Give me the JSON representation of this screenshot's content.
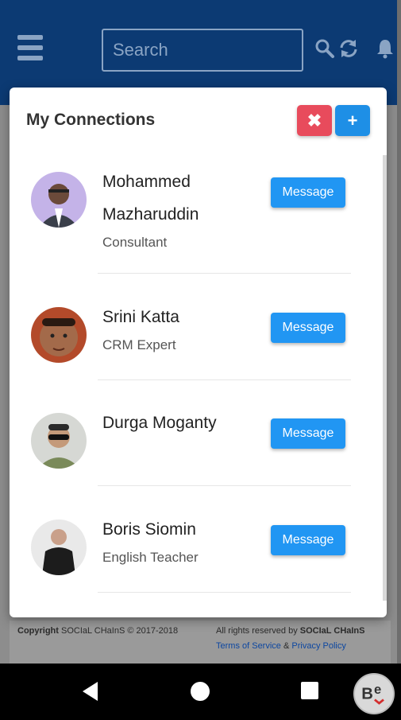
{
  "header": {
    "search_placeholder": "Search"
  },
  "modal": {
    "title": "My Connections",
    "close_icon": "✖",
    "add_icon": "+"
  },
  "connections": [
    {
      "name": "Mohammed Mazharuddin",
      "role": "Consultant",
      "button": "Message"
    },
    {
      "name": "Srini Katta",
      "role": "CRM Expert",
      "button": "Message"
    },
    {
      "name": "Durga Moganty",
      "role": "",
      "button": "Message"
    },
    {
      "name": "Boris Siomin",
      "role": "English Teacher",
      "button": "Message"
    }
  ],
  "footer": {
    "copyright_prefix": "Copyright",
    "copyright_brand": "SOCIaL CHaInS",
    "copyright_years": "© 2017-2018",
    "rights": "All rights reserved by",
    "rights_brand": "SOCIaL CHaInS",
    "terms": "Terms of Service",
    "amp": "&",
    "privacy": "Privacy Policy"
  },
  "colors": {
    "header_bg": "#0c3a73",
    "close_btn": "#e84b5c",
    "add_btn": "#1e8fe6",
    "message_btn": "#2196f3"
  },
  "icons": [
    "hamburger-icon",
    "search-icon",
    "refresh-icon",
    "bell-icon",
    "close-icon",
    "plus-icon",
    "back-icon",
    "home-icon",
    "recents-icon"
  ]
}
